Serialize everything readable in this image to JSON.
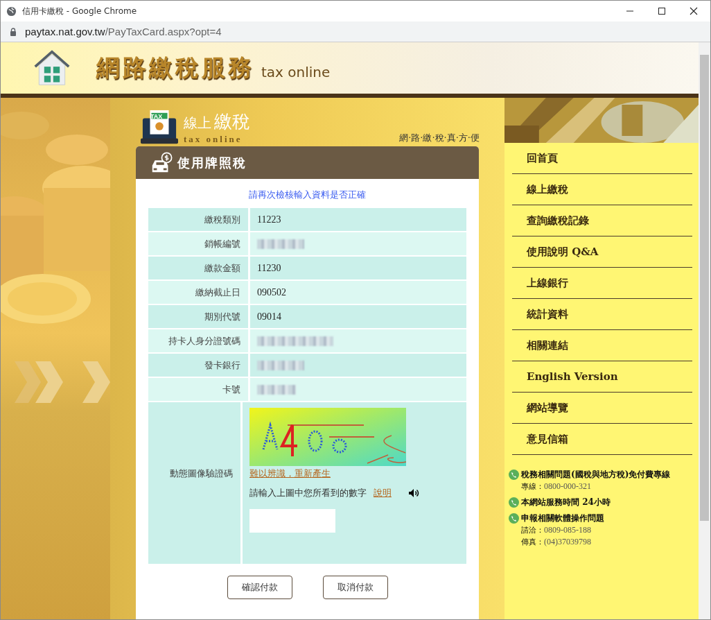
{
  "window": {
    "title": "信用卡繳稅 - Google Chrome"
  },
  "address_bar": {
    "host": "paytax.nat.gov.tw",
    "path": "/PayTaxCard.aspx?opt=4"
  },
  "header": {
    "title": "網路繳稅服務",
    "subtitle": "tax online"
  },
  "section_logo": {
    "badge": "TAX",
    "title_small": "線上",
    "title_large": "繳稅",
    "subtitle": "tax online",
    "slogan": "網·路·繳·稅·真·方·便"
  },
  "card": {
    "title": "使用牌照稅",
    "notice": "請再次檢核輸入資料是否正確",
    "fields": [
      {
        "label": "繳稅類別",
        "kind": "text",
        "value": "11223"
      },
      {
        "label": "銷帳編號",
        "kind": "redacted"
      },
      {
        "label": "繳款金額",
        "kind": "text",
        "value": "11230"
      },
      {
        "label": "繳納截止日",
        "kind": "text",
        "value": "090502"
      },
      {
        "label": "期別代號",
        "kind": "text",
        "value": "09014"
      },
      {
        "label": "持卡人身分證號碼",
        "kind": "redacted"
      },
      {
        "label": "發卡銀行",
        "kind": "redacted"
      },
      {
        "label": "卡號",
        "kind": "redacted"
      }
    ],
    "captcha": {
      "label": "動態圖像驗證碼",
      "refresh_link": "難以辨識，重新產生",
      "prompt": "請輸入上圖中您所看到的數字",
      "help_link": "說明"
    },
    "buttons": [
      "確認付款",
      "取消付款"
    ]
  },
  "menu": [
    "回首頁",
    "線上繳稅",
    "查詢繳稅記錄",
    "使用說明 Q&A",
    "上線銀行",
    "統計資料",
    "相關連結",
    "English Version",
    "網站導覽",
    "意見信箱"
  ],
  "contacts": [
    {
      "title": "稅務相關問題(國稅與地方稅)免付費專線",
      "lines": [
        {
          "label": "專線：",
          "value": "0800-000-321"
        }
      ]
    },
    {
      "title": "本網站服務時間 24小時"
    },
    {
      "title": "申報相關軟體操作問題",
      "lines": [
        {
          "label": "請洽：",
          "value": "0809-085-188"
        },
        {
          "label": "傳真：",
          "value": "(04)37039798"
        }
      ]
    }
  ]
}
